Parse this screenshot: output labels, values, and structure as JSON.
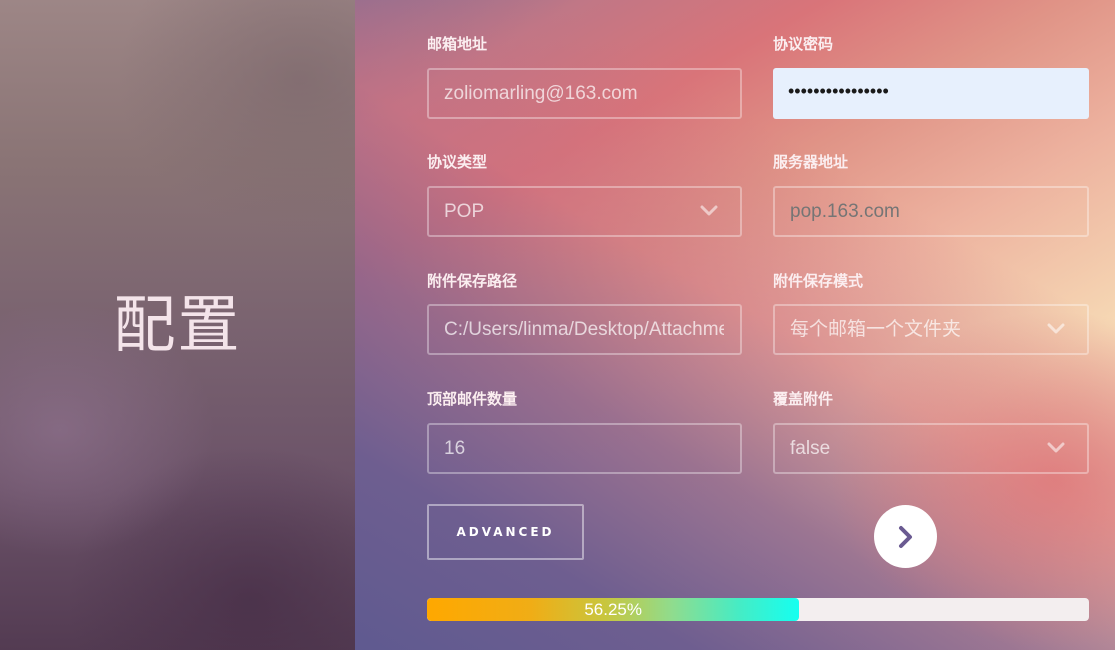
{
  "left": {
    "title": "配置"
  },
  "form": {
    "email": {
      "label": "邮箱地址",
      "value": "zoliomarling@163.com"
    },
    "password": {
      "label": "协议密码",
      "value": "••••••••••••••••"
    },
    "protocol": {
      "label": "协议类型",
      "value": "POP"
    },
    "server": {
      "label": "服务器地址",
      "placeholder": "pop.163.com"
    },
    "attachment_path": {
      "label": "附件保存路径",
      "value": "C:/Users/linma/Desktop/Attachments"
    },
    "attachment_mode": {
      "label": "附件保存模式",
      "value": "每个邮箱一个文件夹"
    },
    "top_count": {
      "label": "顶部邮件数量",
      "value": "16"
    },
    "overwrite": {
      "label": "覆盖附件",
      "value": "false"
    }
  },
  "buttons": {
    "advanced": "ADVANCED",
    "next_icon": "chevron-right-icon"
  },
  "progress": {
    "percent": 56.25,
    "label": "56.25%"
  },
  "colors": {
    "accent": "#6a5a91",
    "progress_start": "#ffa800",
    "progress_end": "#15fff0",
    "password_bg": "#e7f0fd"
  }
}
